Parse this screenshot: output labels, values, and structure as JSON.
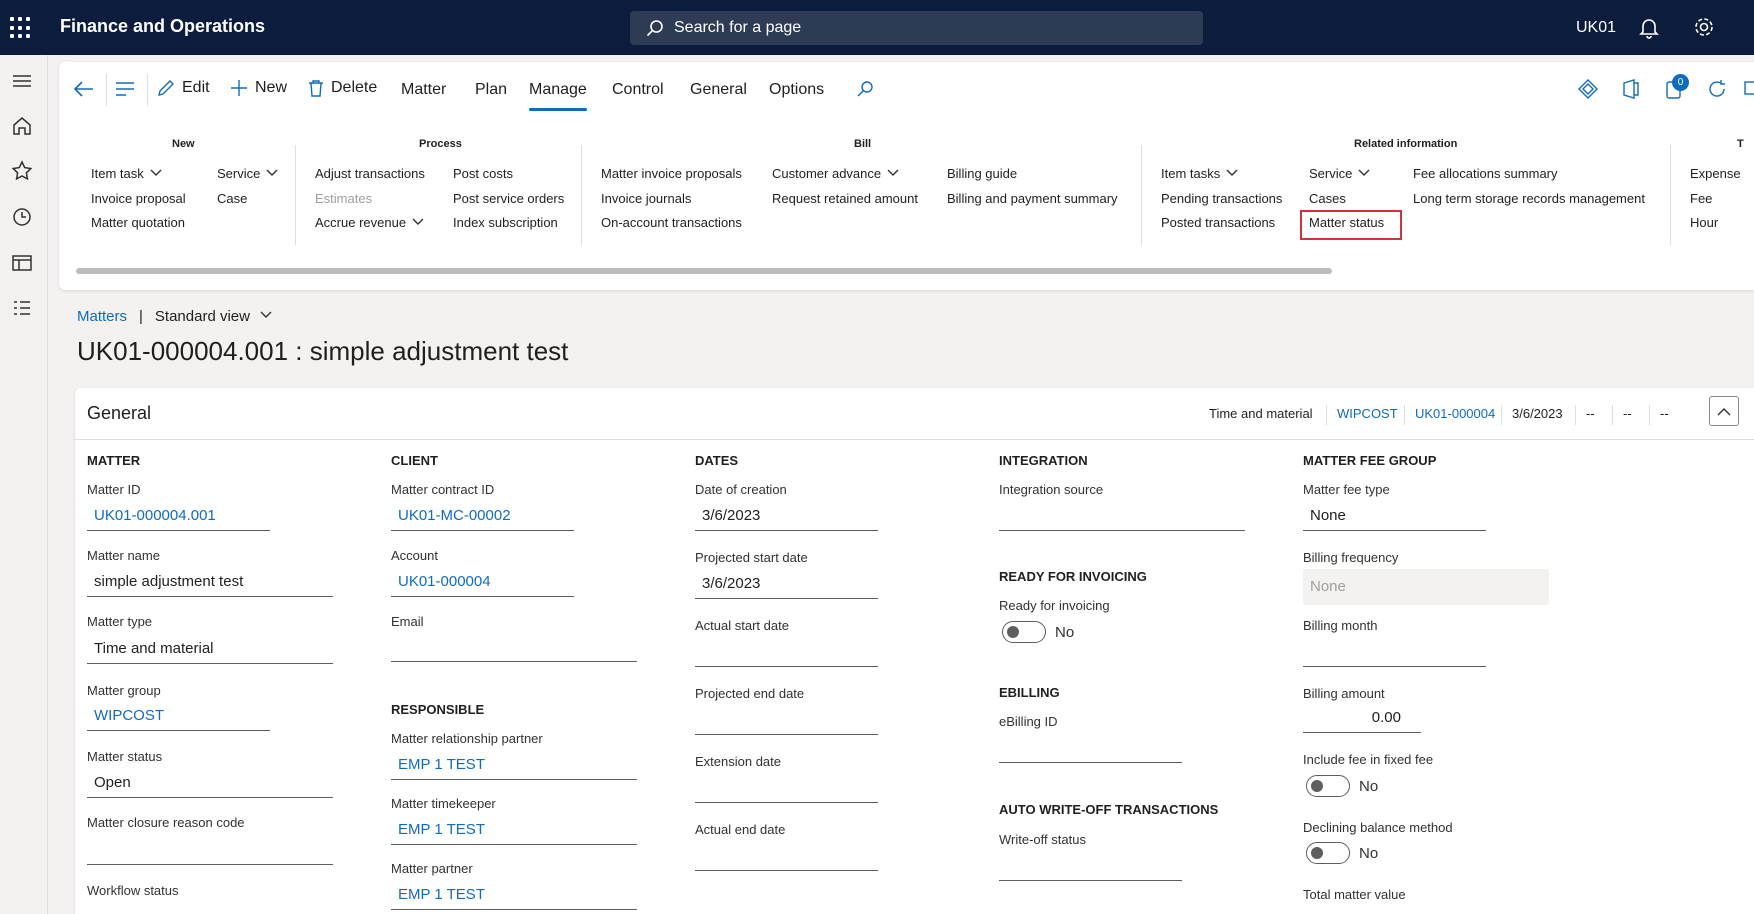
{
  "topbar": {
    "app_title": "Finance and Operations",
    "search_placeholder": "Search for a page",
    "company": "UK01"
  },
  "rail": {
    "icons": [
      "hamburger-icon",
      "home-icon",
      "star-icon",
      "clock-icon",
      "workspace-icon",
      "list-icon"
    ]
  },
  "toolbar": {
    "edit": "Edit",
    "new": "New",
    "delete": "Delete",
    "tabs": [
      "Matter",
      "Plan",
      "Manage",
      "Control",
      "General",
      "Options"
    ],
    "active_tab": "Manage",
    "badge_count": "0"
  },
  "groups": {
    "new": {
      "title": "New",
      "items": [
        "Item task",
        "Invoice proposal",
        "Matter quotation",
        "Service",
        "Case"
      ]
    },
    "process": {
      "title": "Process",
      "items": [
        "Adjust transactions",
        "Estimates",
        "Accrue revenue",
        "Post costs",
        "Post service orders",
        "Index subscription"
      ]
    },
    "bill": {
      "title": "Bill",
      "items": [
        "Matter invoice proposals",
        "Invoice journals",
        "On-account transactions",
        "Customer advance",
        "Request retained amount",
        "Billing guide",
        "Billing and payment summary"
      ]
    },
    "related": {
      "title": "Related information",
      "items": [
        "Item tasks",
        "Pending transactions",
        "Posted transactions",
        "Service",
        "Cases",
        "Matter status",
        "Fee allocations summary",
        "Long term storage records management"
      ]
    },
    "t": {
      "title": "T",
      "items": [
        "Expense",
        "Fee",
        "Hour"
      ]
    }
  },
  "breadcrumb": {
    "link": "Matters",
    "view": "Standard view"
  },
  "page_title": "UK01-000004.001 : simple adjustment test",
  "general": {
    "title": "General",
    "summary": [
      "Time and material",
      "WIPCOST",
      "UK01-000004",
      "3/6/2023",
      "--",
      "--",
      "--"
    ],
    "matter": {
      "section": "MATTER",
      "matter_id_label": "Matter ID",
      "matter_id": "UK01-000004.001",
      "matter_name_label": "Matter name",
      "matter_name": "simple adjustment test",
      "matter_type_label": "Matter type",
      "matter_type": "Time and material",
      "matter_group_label": "Matter group",
      "matter_group": "WIPCOST",
      "matter_status_label": "Matter status",
      "matter_status": "Open",
      "closure_label": "Matter closure reason code",
      "workflow_label": "Workflow status"
    },
    "client": {
      "section": "CLIENT",
      "contract_label": "Matter contract ID",
      "contract": "UK01-MC-00002",
      "account_label": "Account",
      "account": "UK01-000004",
      "email_label": "Email"
    },
    "responsible": {
      "section": "RESPONSIBLE",
      "rel_partner_label": "Matter relationship partner",
      "rel_partner": "EMP 1 TEST",
      "timekeeper_label": "Matter timekeeper",
      "timekeeper": "EMP 1 TEST",
      "partner_label": "Matter partner",
      "partner": "EMP 1 TEST"
    },
    "dates": {
      "section": "DATES",
      "creation_label": "Date of creation",
      "creation": "3/6/2023",
      "proj_start_label": "Projected start date",
      "proj_start": "3/6/2023",
      "actual_start_label": "Actual start date",
      "proj_end_label": "Projected end date",
      "extension_label": "Extension date",
      "actual_end_label": "Actual end date"
    },
    "integration": {
      "section": "INTEGRATION",
      "source_label": "Integration source",
      "ready_section": "READY FOR INVOICING",
      "ready_label": "Ready for invoicing",
      "ready_value": "No",
      "ebilling_section": "EBILLING",
      "ebilling_label": "eBilling ID",
      "writeoff_section": "AUTO WRITE-OFF TRANSACTIONS",
      "writeoff_label": "Write-off status"
    },
    "fee_group": {
      "section": "MATTER FEE GROUP",
      "fee_type_label": "Matter fee type",
      "fee_type": "None",
      "freq_label": "Billing frequency",
      "freq": "None",
      "month_label": "Billing month",
      "amount_label": "Billing amount",
      "amount": "0.00",
      "include_label": "Include fee in fixed fee",
      "include_value": "No",
      "declining_label": "Declining balance method",
      "declining_value": "No",
      "total_label": "Total matter value"
    }
  }
}
